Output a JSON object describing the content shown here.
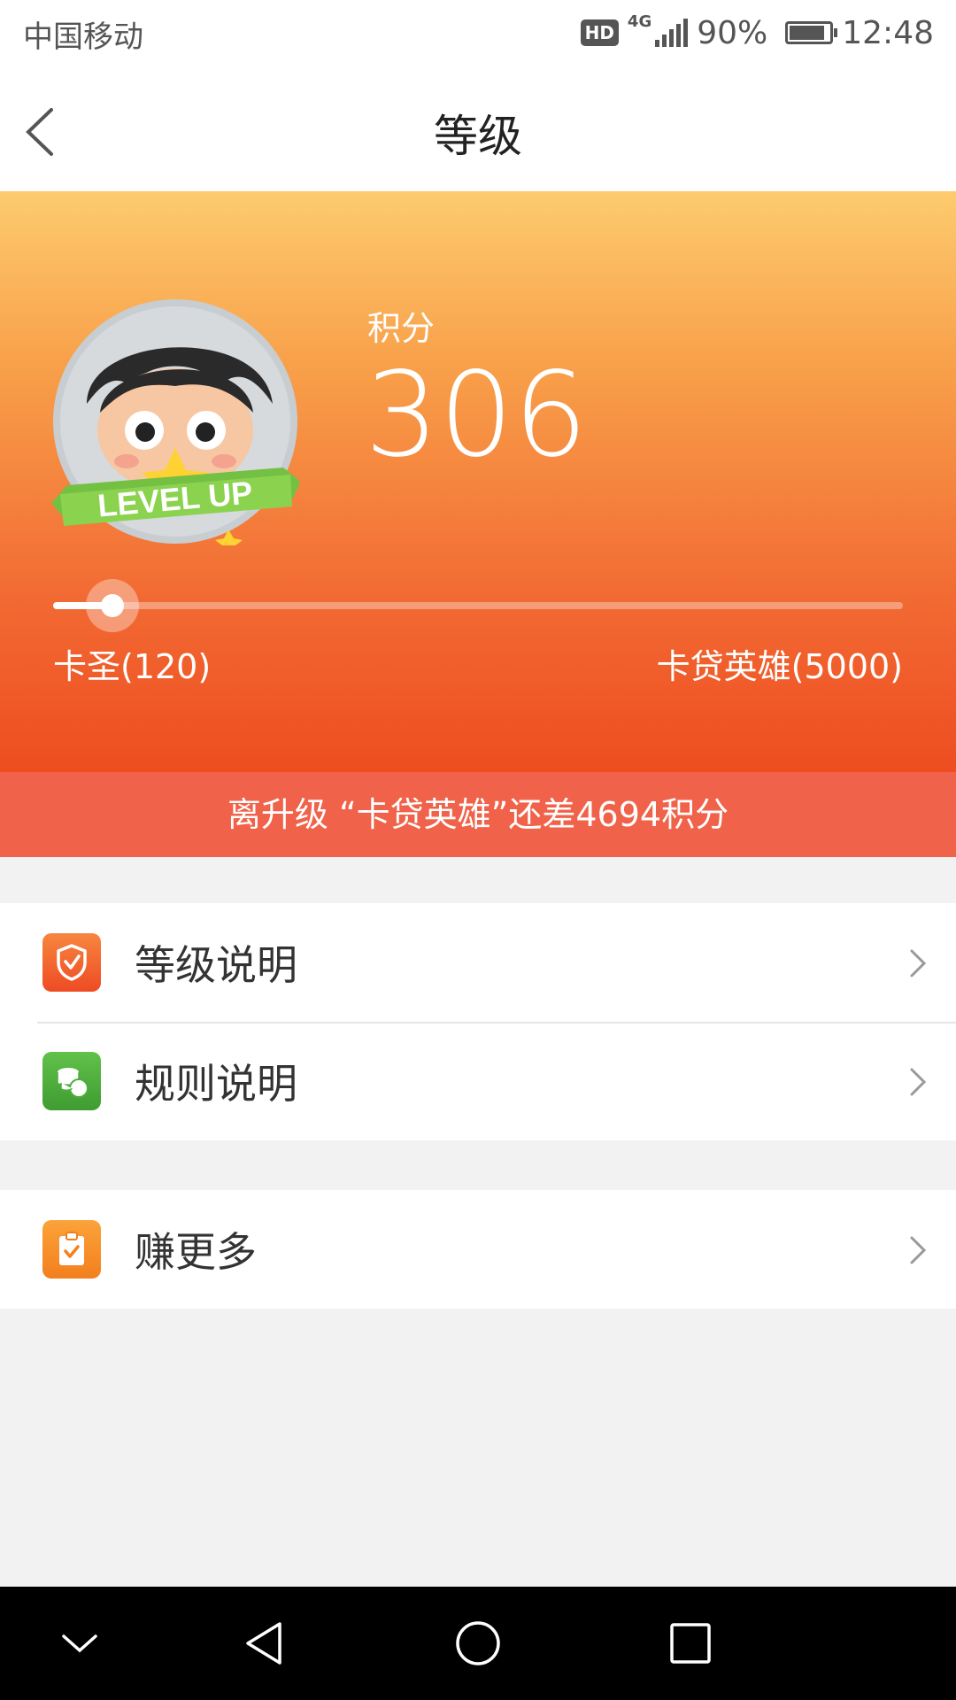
{
  "status_bar": {
    "carrier": "中国移动",
    "hd": "HD",
    "network": "4G",
    "battery_percent": "90%",
    "battery_level": 0.9,
    "time": "12:48"
  },
  "header": {
    "title": "等级",
    "back_icon": "chevron-left-icon"
  },
  "level_card": {
    "avatar_icon": "level-up-avatar",
    "badge_text": "LEVEL UP",
    "points_label": "积分",
    "points_value": "306",
    "progress_fraction": 0.07,
    "current_level": "卡圣(120)",
    "next_level": "卡贷英雄(5000)",
    "upgrade_hint": "离升级 “卡贷英雄”还差4694积分"
  },
  "menu_group_1": [
    {
      "label": "等级说明",
      "icon": "shield-check-icon",
      "icon_color": "#f26a2e"
    },
    {
      "label": "规则说明",
      "icon": "coins-stack-icon",
      "icon_color": "#4cae3c"
    }
  ],
  "menu_group_2": [
    {
      "label": "赚更多",
      "icon": "clipboard-check-icon",
      "icon_color": "#f7902a"
    }
  ],
  "nav_bar": {
    "icons": [
      "collapse-chevron-icon",
      "back-triangle-icon",
      "home-circle-icon",
      "recents-square-icon"
    ]
  },
  "colors": {
    "hero_top": "#fdcb6e",
    "hero_bottom": "#ee4d20",
    "banner": "#f06249"
  }
}
